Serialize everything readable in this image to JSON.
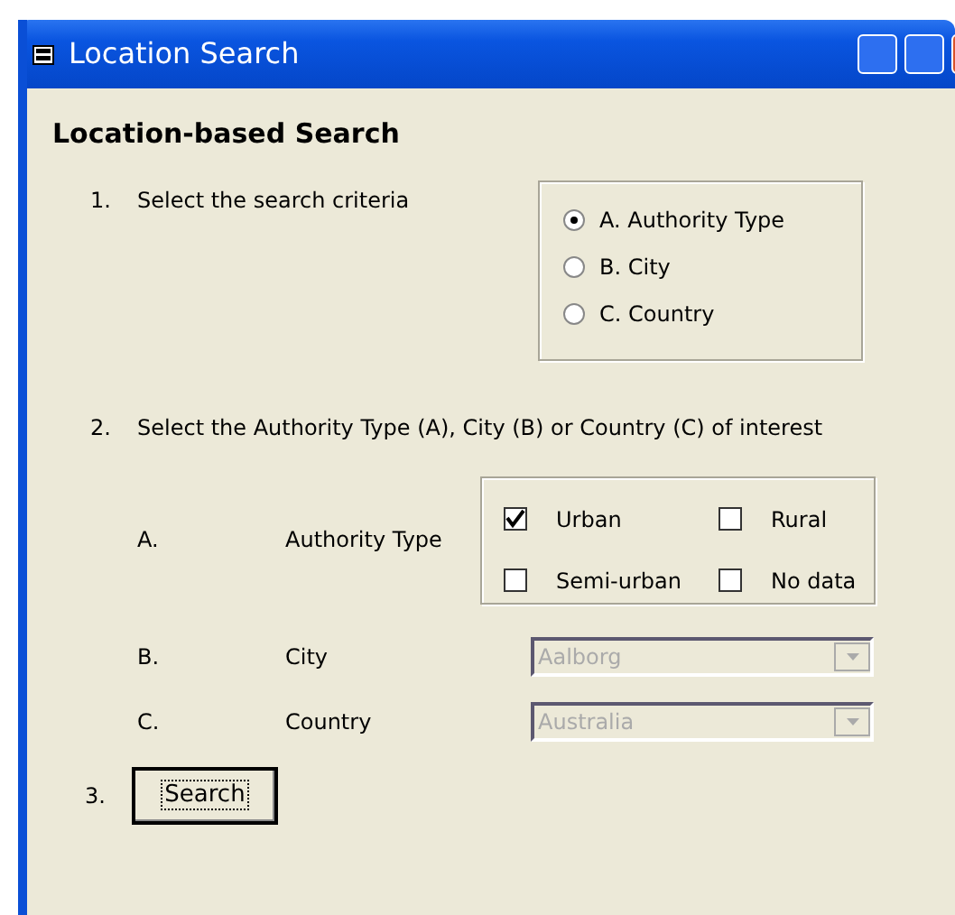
{
  "window": {
    "title": "Location Search"
  },
  "heading": "Location-based Search",
  "step1": {
    "number": "1.",
    "label": "Select the search criteria",
    "options": [
      {
        "label": "A.  Authority Type",
        "selected": true
      },
      {
        "label": "B.  City",
        "selected": false
      },
      {
        "label": "C.  Country",
        "selected": false
      }
    ]
  },
  "step2": {
    "number": "2.",
    "label": "Select the Authority Type (A), City (B) or Country (C) of interest",
    "rows": [
      {
        "kind": "checks",
        "letter": "A.",
        "label": "Authority Type",
        "checks": [
          {
            "label": "Urban",
            "checked": true
          },
          {
            "label": "Rural",
            "checked": false
          },
          {
            "label": "Semi-urban",
            "checked": false
          },
          {
            "label": "No data",
            "checked": false
          }
        ]
      },
      {
        "kind": "combo",
        "letter": "B.",
        "label": "City",
        "value": "Aalborg",
        "disabled": true
      },
      {
        "kind": "combo",
        "letter": "C.",
        "label": "Country",
        "value": "Australia",
        "disabled": true
      }
    ]
  },
  "step3": {
    "number": "3.",
    "button": "Search"
  }
}
